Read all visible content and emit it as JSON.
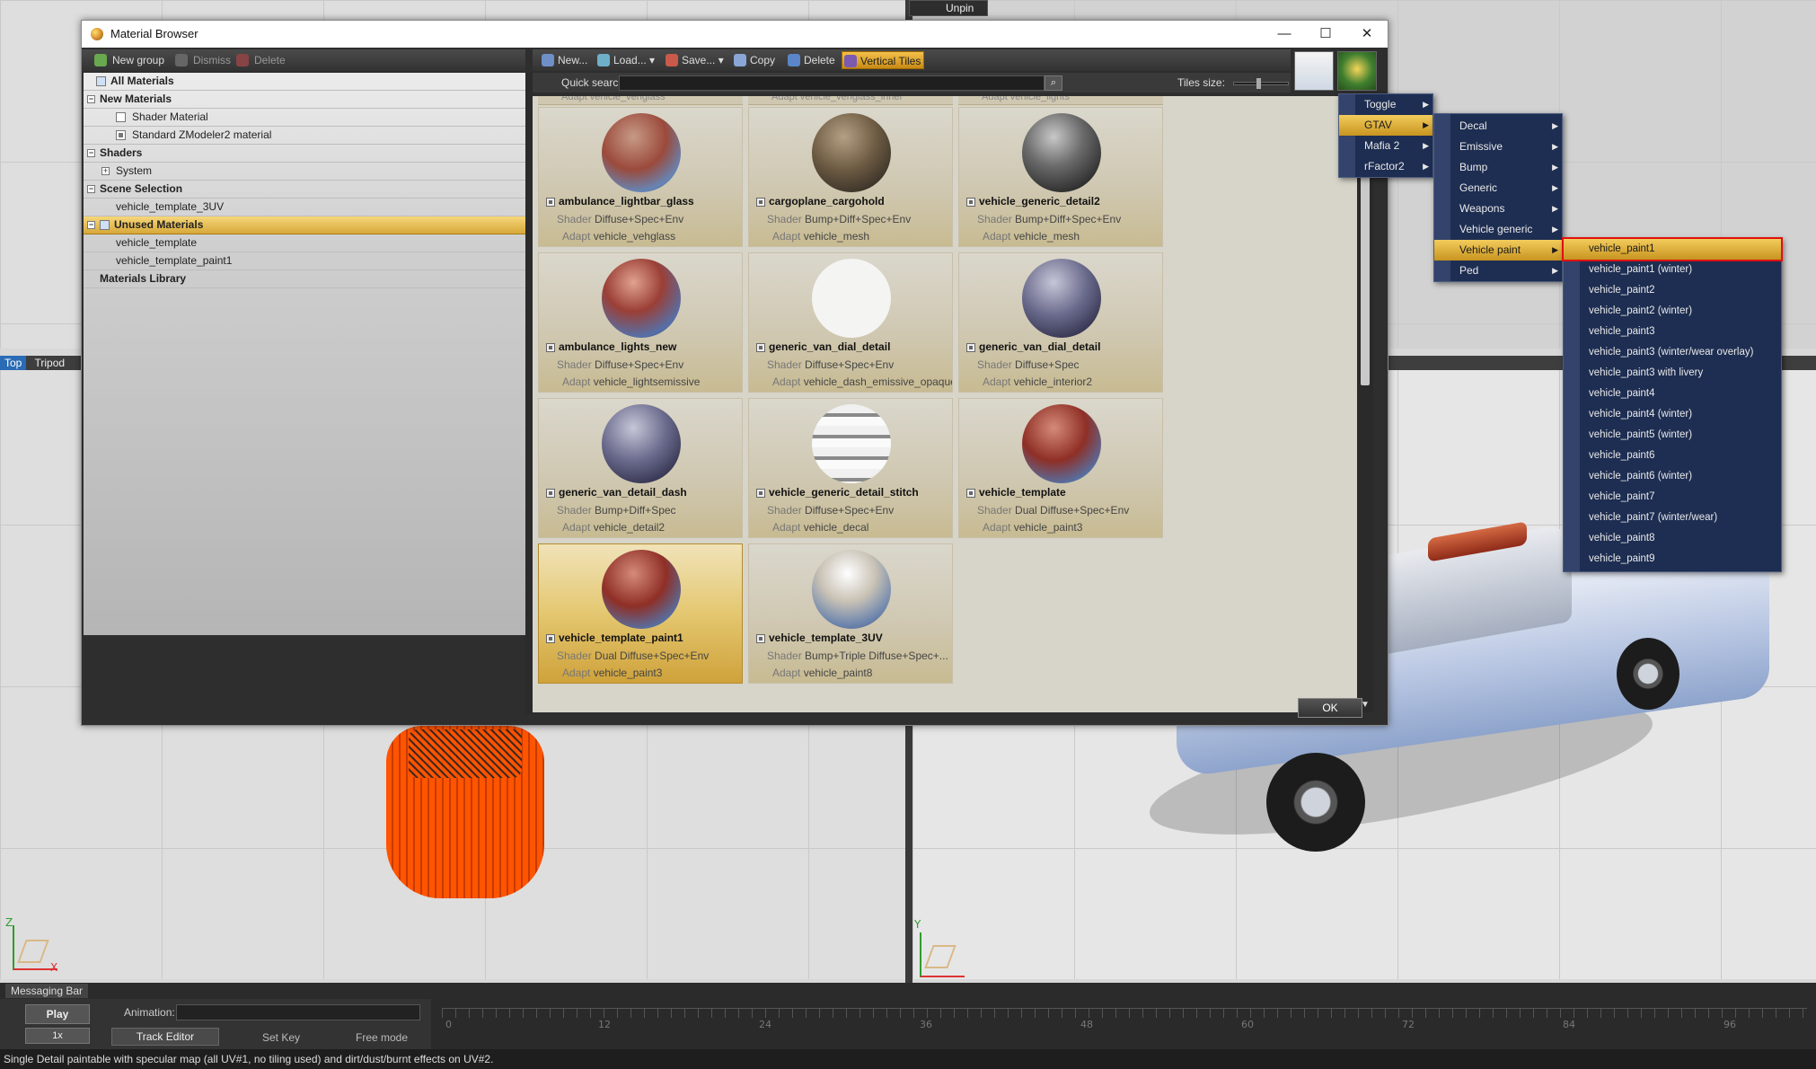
{
  "topbar": {
    "unpin_label": "Unpin"
  },
  "viewports": {
    "bottom_left_tag": "Top",
    "bottom_left_label": "Tripod",
    "axis_z": "Z",
    "axis_x": "X",
    "axis_y": "Y"
  },
  "window": {
    "title": "Material Browser",
    "minimize": "—",
    "maximize": "☐",
    "close": "✕"
  },
  "left_toolbar": {
    "new_group": "New group",
    "dismiss": "Dismiss",
    "delete": "Delete"
  },
  "tree": {
    "all_materials": "All Materials",
    "new_materials": "New Materials",
    "shader_material": "Shader Material",
    "standard_material": "Standard ZModeler2 material",
    "shaders": "Shaders",
    "system": "System",
    "scene_selection": "Scene Selection",
    "vehicle_template_3uv": "vehicle_template_3UV",
    "unused_materials": "Unused Materials",
    "vehicle_template": "vehicle_template",
    "vehicle_template_paint1": "vehicle_template_paint1",
    "materials_library": "Materials Library"
  },
  "right_toolbar": {
    "new": "New...",
    "load": "Load...",
    "save": "Save...",
    "copy": "Copy",
    "delete": "Delete",
    "vertical_tiles": "Vertical Tiles"
  },
  "search": {
    "label": "Quick search:",
    "value": "",
    "tiles_size_label": "Tiles size:"
  },
  "clipped_row": [
    "Adapt vehicle_vehglass",
    "Adapt vehicle_vehglass_inner",
    "Adapt vehicle_lights"
  ],
  "tiles": [
    {
      "name": "ambulance_lightbar_glass",
      "shader": "Diffuse+Spec+Env",
      "adapt": "vehicle_vehglass",
      "shader_label": "Shader",
      "adapt_label": "Adapt"
    },
    {
      "name": "cargoplane_cargohold",
      "shader": "Bump+Diff+Spec+Env",
      "adapt": "vehicle_mesh",
      "shader_label": "Shader",
      "adapt_label": "Adapt"
    },
    {
      "name": "vehicle_generic_detail2",
      "shader": "Bump+Diff+Spec+Env",
      "adapt": "vehicle_mesh",
      "shader_label": "Shader",
      "adapt_label": "Adapt"
    },
    {
      "name": "ambulance_lights_new",
      "shader": "Diffuse+Spec+Env",
      "adapt": "vehicle_lightsemissive",
      "shader_label": "Shader",
      "adapt_label": "Adapt"
    },
    {
      "name": "generic_van_dial_detail",
      "shader": "Diffuse+Spec+Env",
      "adapt": "vehicle_dash_emissive_opaque",
      "shader_label": "Shader",
      "adapt_label": "Adapt"
    },
    {
      "name": "generic_van_dial_detail",
      "shader": "Diffuse+Spec",
      "adapt": "vehicle_interior2",
      "shader_label": "Shader",
      "adapt_label": "Adapt"
    },
    {
      "name": "generic_van_detail_dash",
      "shader": "Bump+Diff+Spec",
      "adapt": "vehicle_detail2",
      "shader_label": "Shader",
      "adapt_label": "Adapt"
    },
    {
      "name": "vehicle_generic_detail_stitch",
      "shader": "Diffuse+Spec+Env",
      "adapt": "vehicle_decal",
      "shader_label": "Shader",
      "adapt_label": "Adapt"
    },
    {
      "name": "vehicle_template",
      "shader": "Dual Diffuse+Spec+Env",
      "adapt": "vehicle_paint3",
      "shader_label": "Shader",
      "adapt_label": "Adapt"
    },
    {
      "name": "vehicle_template_paint1",
      "shader": "Dual Diffuse+Spec+Env",
      "adapt": "vehicle_paint3",
      "shader_label": "Shader",
      "adapt_label": "Adapt"
    },
    {
      "name": "vehicle_template_3UV",
      "shader": "Bump+Triple Diffuse+Spec+...",
      "adapt": "vehicle_paint8",
      "shader_label": "Shader",
      "adapt_label": "Adapt"
    }
  ],
  "ok_label": "OK",
  "menus": {
    "level1": [
      "Toggle",
      "GTAV",
      "Mafia 2",
      "rFactor2"
    ],
    "level2": [
      "Decal",
      "Emissive",
      "Bump",
      "Generic",
      "Weapons",
      "Vehicle generic",
      "Vehicle paint",
      "Ped"
    ],
    "level3": [
      "vehicle_paint1",
      "vehicle_paint1 (winter)",
      "vehicle_paint2",
      "vehicle_paint2 (winter)",
      "vehicle_paint3",
      "vehicle_paint3 (winter/wear overlay)",
      "vehicle_paint3 with livery",
      "vehicle_paint4",
      "vehicle_paint4 (winter)",
      "vehicle_paint5 (winter)",
      "vehicle_paint6",
      "vehicle_paint6 (winter)",
      "vehicle_paint7",
      "vehicle_paint7 (winter/wear)",
      "vehicle_paint8",
      "vehicle_paint9"
    ]
  },
  "bottom": {
    "messaging_bar": "Messaging Bar",
    "play": "Play",
    "speed": "1x",
    "animation_label": "Animation:",
    "track_editor": "Track Editor",
    "set_key": "Set Key",
    "free_mode": "Free mode",
    "ticks": [
      "0",
      "12",
      "24",
      "36",
      "48",
      "60",
      "72",
      "84",
      "96"
    ],
    "status": "Single Detail paintable with specular map (all UV#1, no tiling used) and dirt/dust/burnt effects on UV#2."
  }
}
